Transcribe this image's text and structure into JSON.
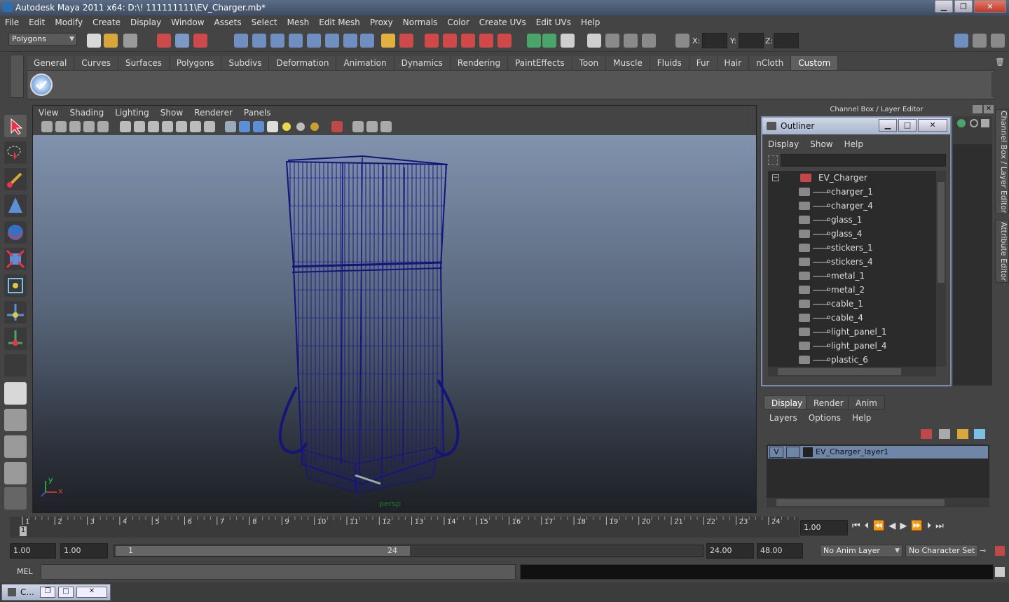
{
  "window": {
    "title": "Autodesk Maya 2011 x64: D:\\! 111111111\\EV_Charger.mb*",
    "min_label": "▁",
    "max_label": "❐",
    "close_label": "✕"
  },
  "menu": [
    "File",
    "Edit",
    "Modify",
    "Create",
    "Display",
    "Window",
    "Assets",
    "Select",
    "Mesh",
    "Edit Mesh",
    "Proxy",
    "Normals",
    "Color",
    "Create UVs",
    "Edit UVs",
    "Help"
  ],
  "status": {
    "mode": "Polygons",
    "x_label": "X:",
    "y_label": "Y:",
    "z_label": "Z:"
  },
  "shelf_tabs": [
    "General",
    "Curves",
    "Surfaces",
    "Polygons",
    "Subdivs",
    "Deformation",
    "Animation",
    "Dynamics",
    "Rendering",
    "PaintEffects",
    "Toon",
    "Muscle",
    "Fluids",
    "Fur",
    "Hair",
    "nCloth",
    "Custom"
  ],
  "active_shelf": "Custom",
  "viewport": {
    "menu": [
      "View",
      "Shading",
      "Lighting",
      "Show",
      "Renderer",
      "Panels"
    ],
    "camera_label": "persp",
    "axis_y": "y",
    "axis_x": "x"
  },
  "channel_box": {
    "title": "Channel Box / Layer Editor"
  },
  "side_tabs": {
    "channel": "Channel Box / Layer Editor",
    "attribute": "Attribute Editor"
  },
  "outliner": {
    "title": "Outliner",
    "menu": [
      "Display",
      "Show",
      "Help"
    ],
    "root": "EV_Charger",
    "items": [
      "charger_1",
      "charger_4",
      "glass_1",
      "glass_4",
      "stickers_1",
      "stickers_4",
      "metal_1",
      "metal_2",
      "cable_1",
      "cable_4",
      "light_panel_1",
      "light_panel_4",
      "plastic_6"
    ]
  },
  "layers": {
    "tabs": [
      "Display",
      "Render",
      "Anim"
    ],
    "menu": [
      "Layers",
      "Options",
      "Help"
    ],
    "visible_flag": "V",
    "layer_name": "EV_Charger_layer1"
  },
  "timeline": {
    "ticks": [
      "1",
      "2",
      "3",
      "4",
      "5",
      "6",
      "7",
      "8",
      "9",
      "10",
      "11",
      "12",
      "13",
      "14",
      "15",
      "16",
      "17",
      "18",
      "19",
      "20",
      "21",
      "22",
      "23",
      "24"
    ],
    "current_frame": "1",
    "current_time": "1.00"
  },
  "range": {
    "start": "1.00",
    "start2": "1.00",
    "slider_start": "1",
    "slider_end": "24",
    "end": "24.00",
    "end2": "48.00",
    "anim_layer": "No Anim Layer",
    "char_set": "No Character Set"
  },
  "cmd": {
    "lang": "MEL"
  },
  "taskbar": {
    "label": "C..."
  },
  "colors": {
    "wire": "#1a1a8c",
    "accent": "#6e86a8"
  }
}
